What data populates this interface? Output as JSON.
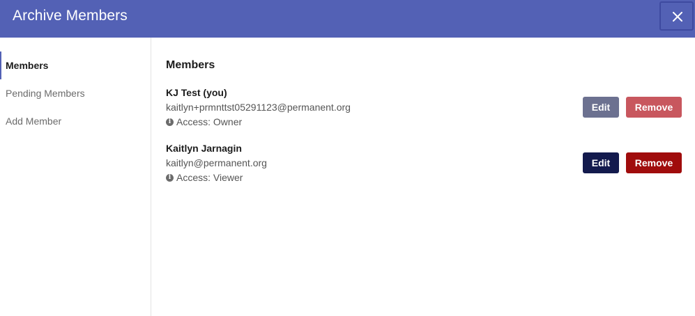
{
  "header": {
    "title": "Archive Members",
    "close_icon": "close-icon"
  },
  "sidebar": {
    "items": [
      {
        "label": "Members",
        "active": true
      },
      {
        "label": "Pending Members",
        "active": false
      },
      {
        "label": "Add Member",
        "active": false
      }
    ]
  },
  "main": {
    "section_title": "Members",
    "members": [
      {
        "name": "KJ Test (you)",
        "email": "kaitlyn+prmnttst05291123@permanent.org",
        "access": "Access: Owner",
        "edit_label": "Edit",
        "remove_label": "Remove",
        "enabled": false
      },
      {
        "name": "Kaitlyn Jarnagin",
        "email": "kaitlyn@permanent.org",
        "access": "Access: Viewer",
        "edit_label": "Edit",
        "remove_label": "Remove",
        "enabled": true
      }
    ]
  },
  "colors": {
    "header": "#5361b5",
    "edit": "#131a4d",
    "remove": "#a00c0c"
  }
}
